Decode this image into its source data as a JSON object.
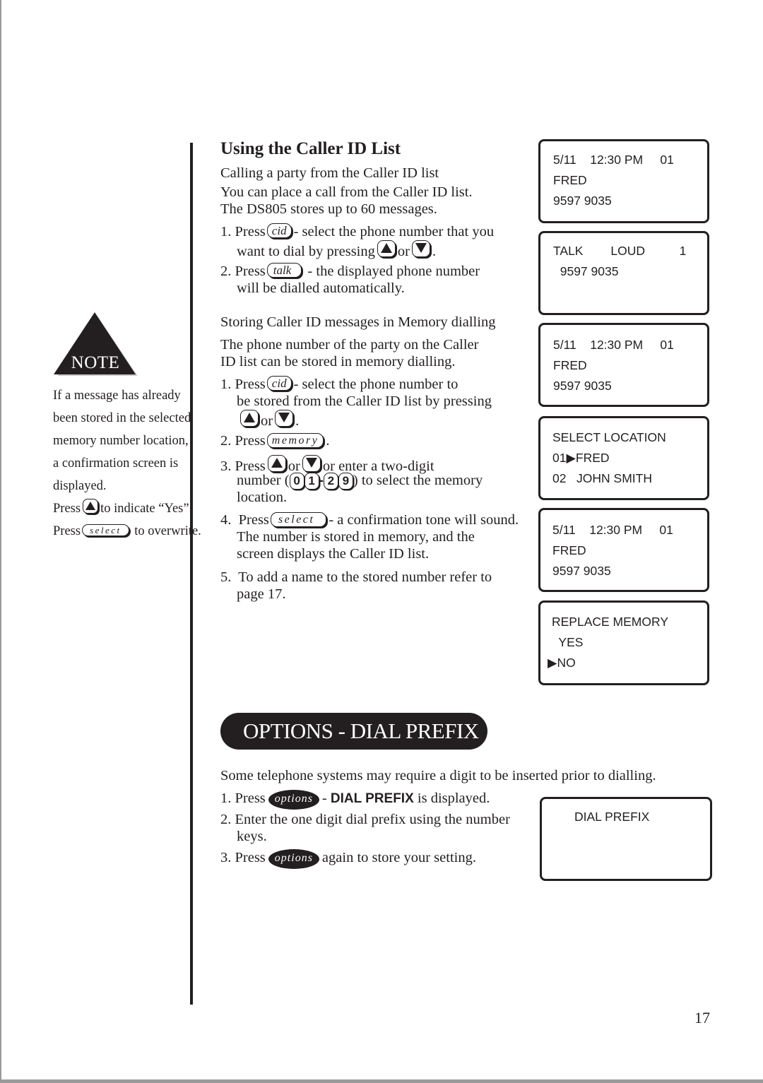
{
  "page_number": "17",
  "note": {
    "badge": "NOTE",
    "lines": [
      "If a message has already",
      "been stored in the selected",
      "memory number location,",
      "a confirmation screen is",
      "displayed."
    ],
    "press_up": {
      "prefix": "Press",
      "icon": "up-arrow-key-icon",
      "suffix": "to indicate “Yes”."
    },
    "press_select": {
      "prefix": "Press",
      "key": "select",
      "suffix": "to overwrite."
    }
  },
  "caller_id": {
    "title": "Using the Caller ID List",
    "subheading": "Calling a party from the Caller ID list",
    "intro": [
      "You can place a call from the Caller ID list.",
      "The DS805 stores up to 60 messages."
    ],
    "steps": [
      {
        "num": "1.",
        "press": "Press",
        "key": "cid",
        "text": "- select the phone number that you",
        "cont": "want to dial by pressing",
        "or": "or",
        "end": "."
      },
      {
        "num": "2.",
        "press": "Press",
        "key": "talk",
        "text": "- the displayed phone number",
        "cont": "will be dialled automatically."
      }
    ]
  },
  "storing": {
    "subheading": "Storing Caller ID messages in Memory dialling",
    "intro": [
      "The phone number of the party on the Caller",
      "ID list can be stored in memory dialling."
    ],
    "step1": {
      "num": "1.",
      "press": "Press",
      "key": "cid",
      "text": "- select the phone number to",
      "cont": "be stored from the Caller ID list by pressing",
      "or": "or",
      "end": "."
    },
    "step2": {
      "num": "2.",
      "press": "Press",
      "key": "memory",
      "end": "."
    },
    "step3": {
      "num": "3.",
      "press": "Press",
      "or1": "or",
      "text": "or enter a two-digit",
      "cont_prefix": "number (",
      "digits": [
        "0",
        "1",
        "2",
        "9"
      ],
      "dash": "-",
      "cont_suffix": ") to select the memory",
      "cont2": "location."
    },
    "step4": {
      "num": "4.",
      "press": "Press",
      "key": "select",
      "text": "- a confirmation tone will sound.",
      "cont": "The number is stored in memory, and the",
      "cont2": "screen displays the Caller ID list."
    },
    "step5": {
      "num": "5.",
      "text": "To add a name to the stored number refer to",
      "cont": "page 17."
    }
  },
  "screens": [
    {
      "lines": [
        "5/11    12:30 PM     01",
        "FRED",
        "9597 9035"
      ]
    },
    {
      "lines": [
        "TALK        LOUD          1",
        "  9597 9035"
      ]
    },
    {
      "lines": [
        "5/11    12:30 PM     01",
        "FRED",
        "9597 9035"
      ]
    },
    {
      "lines": [
        "SELECT LOCATION",
        "01▶FRED",
        "02   JOHN SMITH"
      ]
    },
    {
      "lines": [
        "5/11    12:30 PM     01",
        "FRED",
        "9597 9035"
      ]
    },
    {
      "lines": [
        "REPLACE MEMORY",
        "  YES",
        "▶NO"
      ]
    },
    {
      "lines": [
        "DIAL PREFIX"
      ]
    }
  ],
  "dial_prefix": {
    "banner": "OPTIONS - DIAL PREFIX",
    "intro": "Some telephone systems may require a digit to be inserted prior to dialling.",
    "step1": {
      "num": "1.",
      "press": "Press",
      "key": "options",
      "dash": "-",
      "bold": "DIAL PREFIX",
      "text": "is displayed."
    },
    "step2": {
      "num": "2.",
      "text": "Enter the one digit dial prefix using the number",
      "cont": "keys."
    },
    "step3": {
      "num": "3.",
      "press": "Press",
      "key": "options",
      "text": "again to store your setting."
    }
  }
}
